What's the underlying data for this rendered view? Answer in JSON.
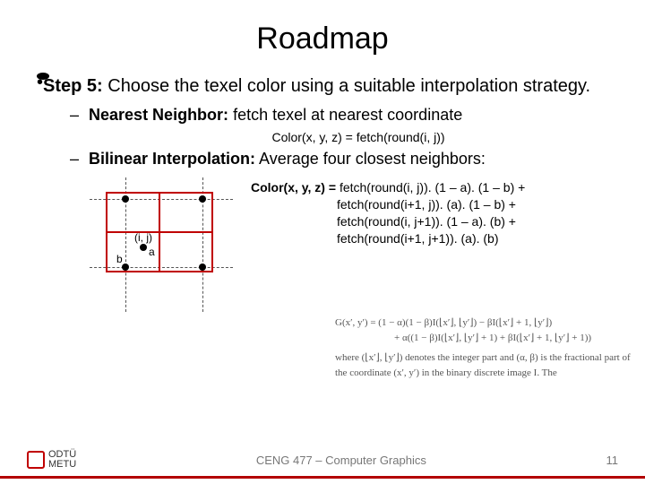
{
  "title": "Roadmap",
  "step_label": "Step 5:",
  "step_text": " Choose the texel color using a suitable interpolation strategy.",
  "nearest_label": "Nearest Neighbor:",
  "nearest_text": " fetch texel at nearest coordinate",
  "nearest_formula": "Color(x, y, z) = fetch(round(i, j))",
  "bilinear_label": "Bilinear Interpolation:",
  "bilinear_text": " Average four closest neighbors:",
  "diagram": {
    "ij_label": "(i, j)",
    "a_label": "a",
    "b_label": "b"
  },
  "bilinear_formula": {
    "lhs": "Color(x, y, z) = ",
    "t1": "fetch(round(i, j)). (1 – a). (1 – b) +",
    "t2": "fetch(round(i+1, j)). (a). (1 – b) +",
    "t3": "fetch(round(i, j+1)). (1 – a). (b) +",
    "t4": "fetch(round(i+1, j+1)). (a). (b)"
  },
  "gray_eq": {
    "g1": "G(x′, y′) = (1 − α)(1 − β)I(⌊x′⌋, ⌊y′⌋) − βI(⌊x′⌋ + 1, ⌊y′⌋)",
    "g2": "+ α((1 − β)I(⌊x′⌋, ⌊y′⌋ + 1) + βI(⌊x′⌋ + 1, ⌊y′⌋ + 1))",
    "where": "where (⌊x′⌋, ⌊y′⌋) denotes the integer part and (α, β) is the fractional part of the coordinate (x′, y′) in the binary discrete image I. The"
  },
  "footer": {
    "course": "CENG 477 – Computer Graphics",
    "page": "11",
    "logo_line1": "ODTÜ",
    "logo_line2": "METU"
  }
}
